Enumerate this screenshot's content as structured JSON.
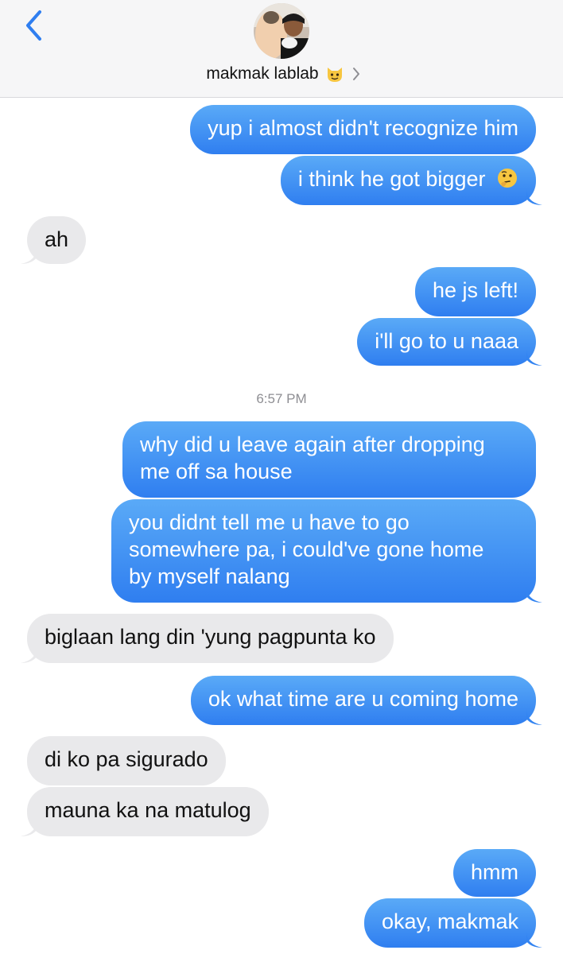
{
  "header": {
    "contact_name": "makmak lablab",
    "back_icon": "chevron-left-icon",
    "contact_emoji": "cat-emoji",
    "chevron_icon": "chevron-right-icon"
  },
  "thread": {
    "timestamp": "6:57 PM",
    "messages": [
      {
        "dir": "sent",
        "text": "yup i almost didn't recognize him"
      },
      {
        "dir": "sent",
        "text": "i think he got bigger",
        "emoji": "thinking-face"
      },
      {
        "dir": "received",
        "text": "ah"
      },
      {
        "dir": "sent",
        "text": "he js left!"
      },
      {
        "dir": "sent",
        "text": "i'll go to u naaa"
      },
      {
        "dir": "sent",
        "text_line1": "why did u leave again after dropping",
        "text_line2": "me off sa house"
      },
      {
        "dir": "sent",
        "text_line1": "you didnt tell me u have to go",
        "text_line2": "somewhere pa, i could've gone home",
        "text_line3": "by myself nalang"
      },
      {
        "dir": "received",
        "text": "biglaan lang din 'yung pagpunta ko"
      },
      {
        "dir": "sent",
        "text": "ok what time are u coming home"
      },
      {
        "dir": "received",
        "text": "di ko pa sigurado"
      },
      {
        "dir": "received",
        "text": "mauna ka na matulog"
      },
      {
        "dir": "sent",
        "text": "hmm"
      },
      {
        "dir": "sent",
        "text": "okay, makmak"
      }
    ]
  },
  "colors": {
    "sent_bubble_top": "#5aaaf7",
    "sent_bubble_bottom": "#2f7ef0",
    "received_bubble": "#e9e9eb",
    "accent": "#2f7ef0"
  }
}
